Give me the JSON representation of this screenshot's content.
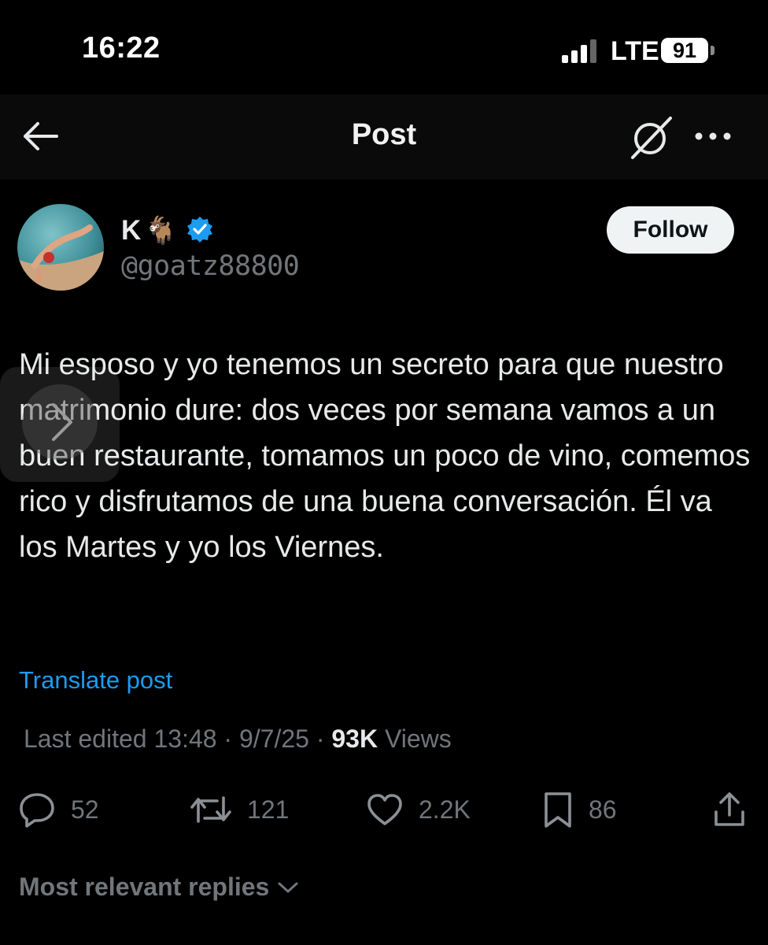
{
  "status_bar": {
    "time": "16:22",
    "network": "LTE",
    "battery": "91"
  },
  "header": {
    "title": "Post",
    "grok_icon": "grok-icon",
    "more_icon": "more-icon",
    "back_icon": "back-arrow-icon"
  },
  "author": {
    "name": "K",
    "name_emoji": "🐐",
    "handle": "@goatz88800",
    "verified_icon": "verified-badge-icon",
    "follow_label": "Follow"
  },
  "post": {
    "text": "Mi esposo y yo tenemos un secreto para que nuestro matrimonio dure: dos veces por semana vamos a un buen restaurante, tomamos un poco de vino, comemos rico y disfrutamos de una buena conversación. Él va los Martes y yo los Viernes.",
    "translate_label": "Translate post",
    "edited_label": "Last edited 13:48 · 9/7/25",
    "views_count": "93K",
    "views_label": "Views"
  },
  "actions": {
    "replies": "52",
    "reposts": "121",
    "likes": "2.2K",
    "bookmarks": "86"
  },
  "replies_sort": {
    "label": "Most relevant replies"
  },
  "colors": {
    "accent": "#1d9bf0",
    "verified": "#1d9bf0",
    "muted": "#71767b",
    "background": "#000000"
  }
}
